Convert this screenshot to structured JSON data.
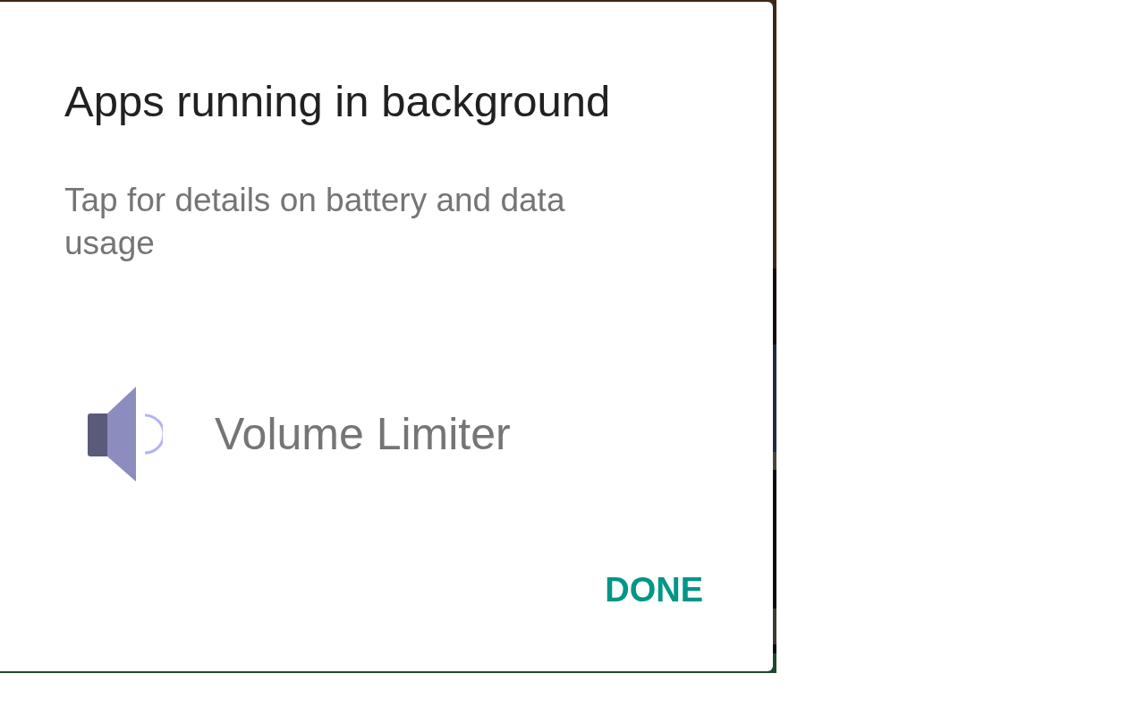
{
  "dialog": {
    "title": "Apps running in background",
    "message": "Tap for details on battery and data usage",
    "apps": [
      {
        "name": "Volume Limiter"
      }
    ],
    "buttons": [
      {
        "label": "DONE"
      }
    ]
  }
}
